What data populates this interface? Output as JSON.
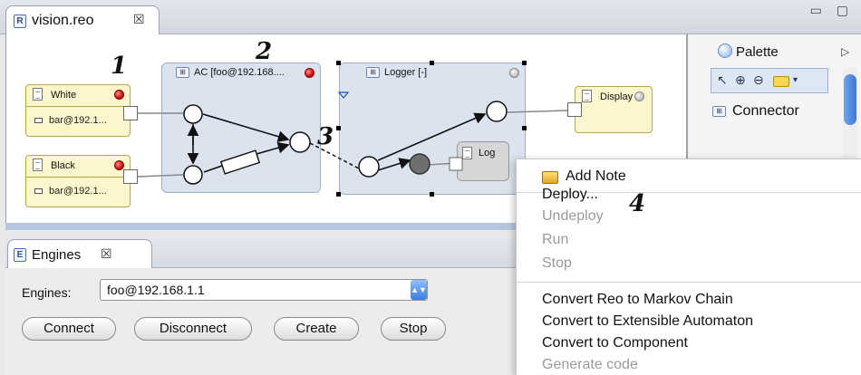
{
  "editor": {
    "tab_title": "vision.reo",
    "tab_close": "☒",
    "window_controls": "▭ ▢"
  },
  "diagram": {
    "components": {
      "white": {
        "label": "White",
        "sub": "bar@192.1..."
      },
      "black": {
        "label": "Black",
        "sub": "bar@192.1..."
      },
      "ac": {
        "label": "AC [foo@192.168...."
      },
      "logger": {
        "label": "Logger [-]"
      },
      "log": {
        "label": "Log"
      },
      "display": {
        "label": "Display"
      }
    },
    "annotations": [
      "1",
      "2",
      "3",
      "4"
    ]
  },
  "palette": {
    "title": "Palette",
    "items": [
      "Connector"
    ]
  },
  "engines_panel": {
    "tab_title": "Engines",
    "tab_close": "☒",
    "engines_label": "Engines:",
    "selected_engine": "foo@192.168.1.1",
    "buttons": {
      "connect": "Connect",
      "disconnect": "Disconnect",
      "create": "Create",
      "stop": "Stop"
    }
  },
  "context_menu": {
    "add_note": "Add Note",
    "deploy": "Deploy...",
    "undeploy": "Undeploy",
    "run": "Run",
    "stop": "Stop",
    "convert_markov": "Convert Reo to Markov Chain",
    "convert_automaton": "Convert to Extensible Automaton",
    "convert_component": "Convert to Component",
    "generate_code": "Generate code"
  },
  "colors": {
    "accent": "#3b78d8",
    "component_fill": "#dbe4ee",
    "port_fill": "#fbf6cc",
    "status_red": "#d01010"
  }
}
